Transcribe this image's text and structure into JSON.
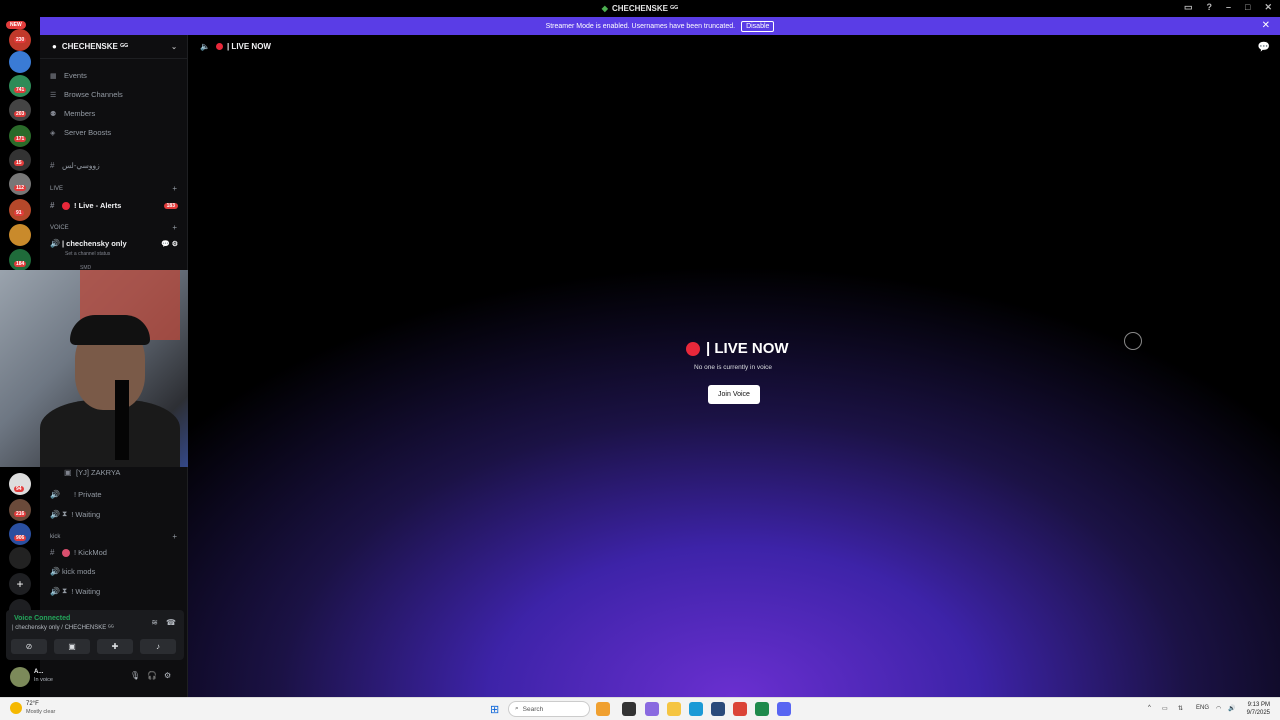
{
  "titlebar": {
    "title": "CHECHENSKE ᴳᴳ"
  },
  "streamer_bar": {
    "message": "Streamer Mode is enabled. Usernames have been truncated.",
    "disable_label": "Disable"
  },
  "guilds": {
    "new_label": "NEW",
    "badges": [
      "230",
      "741",
      "203",
      "171",
      "15",
      "112",
      "91",
      "184",
      "94",
      "216",
      "906"
    ]
  },
  "sidebar": {
    "server_name": "CHECHENSKE ᴳᴳ",
    "menu": [
      {
        "label": "Events",
        "icon": "calendar-icon"
      },
      {
        "label": "Browse Channels",
        "icon": "list-icon"
      },
      {
        "label": "Members",
        "icon": "members-icon"
      },
      {
        "label": "Server Boosts",
        "icon": "boost-icon"
      }
    ],
    "arabic_channel": "زووسي-لس",
    "cat_live": "LIVE",
    "live_alerts": {
      "label": "! Live - Alerts",
      "badge": "183"
    },
    "cat_voice": "VOICE",
    "voice_channel": {
      "label": "| chechensky only",
      "status": "Set a channel status"
    },
    "voice_user_partial": "SMD",
    "zakrya": "[YJ] ZAKRYA",
    "private": "! Private",
    "waiting1": "! Waiting",
    "cat_kick": "kick",
    "kickmod": "! KickMod",
    "kick_mods": "kick mods",
    "waiting2": "! Waiting"
  },
  "voice_panel": {
    "title": "Voice Connected",
    "subtitle": "| chechensky only / CHECHENSKE ᴳᴳ"
  },
  "user_panel": {
    "name": "A...",
    "status": "In voice"
  },
  "main": {
    "header": "| LIVE NOW",
    "center_title": "| LIVE NOW",
    "center_sub": "No one is currently in voice",
    "join_label": "Join Voice"
  },
  "taskbar": {
    "temp": "72°F",
    "weather": "Mostly clear",
    "search": "Search",
    "lang": "ENG",
    "time": "9:13 PM",
    "date": "9/7/2025"
  }
}
